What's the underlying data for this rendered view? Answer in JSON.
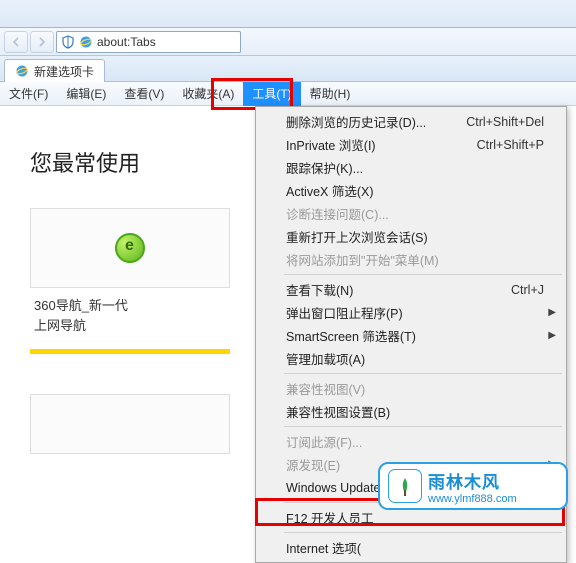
{
  "address": {
    "url": "about:Tabs"
  },
  "tab": {
    "title": "新建选项卡"
  },
  "menubar": {
    "file": "文件(F)",
    "edit": "编辑(E)",
    "view": "查看(V)",
    "favorites": "收藏夹(A)",
    "tools": "工具(T)",
    "help": "帮助(H)"
  },
  "page": {
    "heading": "您最常使用",
    "tile1": {
      "line1": "360导航_新一代",
      "line2": "上网导航"
    }
  },
  "dropdown": {
    "items": [
      {
        "label": "删除浏览的历史记录(D)...",
        "shortcut": "Ctrl+Shift+Del",
        "disabled": false
      },
      {
        "label": "InPrivate 浏览(I)",
        "shortcut": "Ctrl+Shift+P",
        "disabled": false
      },
      {
        "label": "跟踪保护(K)...",
        "disabled": false
      },
      {
        "label": "ActiveX 筛选(X)",
        "disabled": false
      },
      {
        "label": "诊断连接问题(C)...",
        "disabled": true
      },
      {
        "label": "重新打开上次浏览会话(S)",
        "disabled": false
      },
      {
        "label": "将网站添加到\"开始\"菜单(M)",
        "disabled": true
      },
      {
        "sep": true
      },
      {
        "label": "查看下载(N)",
        "shortcut": "Ctrl+J",
        "disabled": false
      },
      {
        "label": "弹出窗口阻止程序(P)",
        "arrow": true,
        "disabled": false
      },
      {
        "label": "SmartScreen 筛选器(T)",
        "arrow": true,
        "disabled": false
      },
      {
        "label": "管理加载项(A)",
        "disabled": false
      },
      {
        "sep": true
      },
      {
        "label": "兼容性视图(V)",
        "disabled": true
      },
      {
        "label": "兼容性视图设置(B)",
        "disabled": false
      },
      {
        "sep": true
      },
      {
        "label": "订阅此源(F)...",
        "disabled": true
      },
      {
        "label": "源发现(E)",
        "arrow": true,
        "disabled": true
      },
      {
        "label": "Windows Update(U)",
        "disabled": false
      },
      {
        "sep": true
      },
      {
        "label": "F12 开发人员工",
        "disabled": false
      },
      {
        "sep": true
      },
      {
        "label": "Internet 选项(",
        "disabled": false
      }
    ]
  },
  "watermark": {
    "cn": "雨林木风",
    "url": "www.ylmf888.com"
  }
}
